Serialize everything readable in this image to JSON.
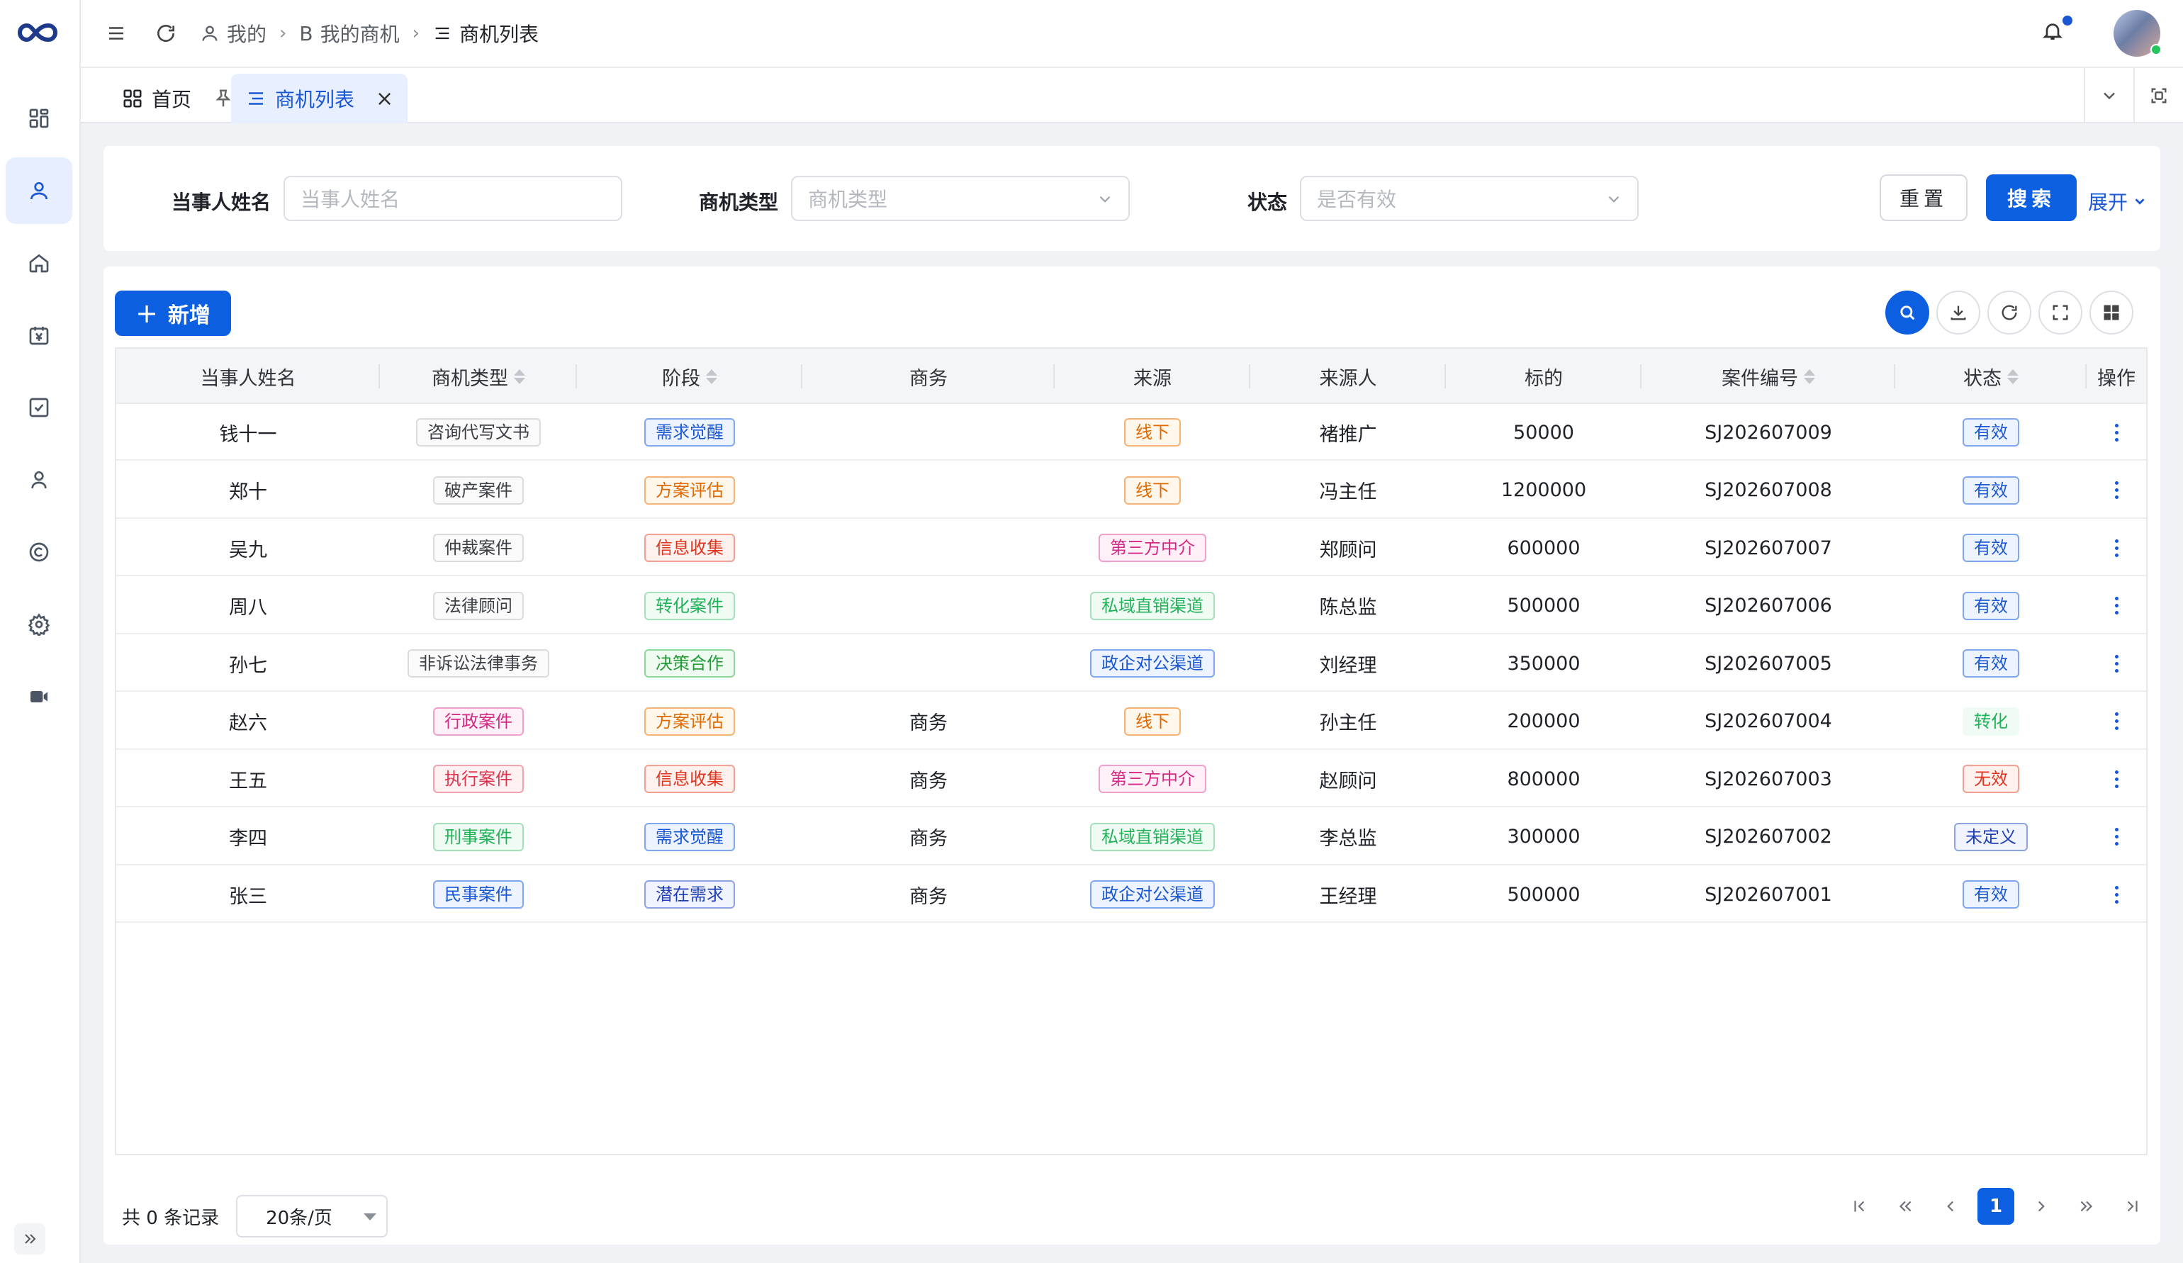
{
  "sidebar": {
    "items": [
      {
        "icon": "dashboard-icon",
        "active": false
      },
      {
        "icon": "user-icon",
        "active": true
      },
      {
        "icon": "home-icon",
        "active": false
      },
      {
        "icon": "yen-calendar-icon",
        "active": false
      },
      {
        "icon": "checkbox-icon",
        "active": false
      },
      {
        "icon": "person-icon",
        "active": false
      },
      {
        "icon": "copyright-icon",
        "active": false
      },
      {
        "icon": "settings-icon",
        "active": false
      },
      {
        "icon": "video-icon",
        "active": false
      }
    ]
  },
  "header": {
    "breadcrumbs": [
      {
        "label": "我的",
        "icon": "user-icon"
      },
      {
        "label": "我的商机",
        "icon": "b-letter-icon"
      },
      {
        "label": "商机列表",
        "icon": "list-icon"
      }
    ]
  },
  "tabs": [
    {
      "label": "首页",
      "icon": "dashboard-icon",
      "active": false
    },
    {
      "label": "商机列表",
      "icon": "list-icon",
      "active": true
    }
  ],
  "filters": {
    "party_name": {
      "label": "当事人姓名",
      "placeholder": "当事人姓名",
      "value": ""
    },
    "opportunity_type": {
      "label": "商机类型",
      "placeholder": "商机类型",
      "value": ""
    },
    "status": {
      "label": "状态",
      "placeholder": "是否有效",
      "value": ""
    },
    "reset_label": "重置",
    "search_label": "搜索",
    "expand_label": "展开"
  },
  "toolbar": {
    "add_label": "新增"
  },
  "table": {
    "columns": [
      "当事人姓名",
      "商机类型",
      "阶段",
      "商务",
      "来源",
      "来源人",
      "标的",
      "案件编号",
      "状态",
      "操作"
    ],
    "rows": [
      {
        "name": "钱十一",
        "type": "咨询代写文书",
        "type_color": "gray",
        "stage": "需求觉醒",
        "stage_color": "blue",
        "biz": "",
        "source": "线下",
        "source_color": "orange",
        "referrer": "褚推广",
        "amount": "50000",
        "case_no": "SJ202607009",
        "status": "有效",
        "status_color": "blue"
      },
      {
        "name": "郑十",
        "type": "破产案件",
        "type_color": "gray",
        "stage": "方案评估",
        "stage_color": "orange",
        "biz": "",
        "source": "线下",
        "source_color": "orange",
        "referrer": "冯主任",
        "amount": "1200000",
        "case_no": "SJ202607008",
        "status": "有效",
        "status_color": "blue"
      },
      {
        "name": "吴九",
        "type": "仲裁案件",
        "type_color": "gray",
        "stage": "信息收集",
        "stage_color": "red",
        "biz": "",
        "source": "第三方中介",
        "source_color": "magenta",
        "referrer": "郑顾问",
        "amount": "600000",
        "case_no": "SJ202607007",
        "status": "有效",
        "status_color": "blue"
      },
      {
        "name": "周八",
        "type": "法律顾问",
        "type_color": "gray",
        "stage": "转化案件",
        "stage_color": "green",
        "biz": "",
        "source": "私域直销渠道",
        "source_color": "green",
        "referrer": "陈总监",
        "amount": "500000",
        "case_no": "SJ202607006",
        "status": "有效",
        "status_color": "blue"
      },
      {
        "name": "孙七",
        "type": "非诉讼法律事务",
        "type_color": "gray",
        "stage": "决策合作",
        "stage_color": "darkgreen",
        "biz": "",
        "source": "政企对公渠道",
        "source_color": "blue",
        "referrer": "刘经理",
        "amount": "350000",
        "case_no": "SJ202607005",
        "status": "有效",
        "status_color": "blue"
      },
      {
        "name": "赵六",
        "type": "行政案件",
        "type_color": "magenta",
        "stage": "方案评估",
        "stage_color": "orange",
        "biz": "商务",
        "source": "线下",
        "source_color": "orange",
        "referrer": "孙主任",
        "amount": "200000",
        "case_no": "SJ202607004",
        "status": "转化",
        "status_color": "plain-green"
      },
      {
        "name": "王五",
        "type": "执行案件",
        "type_color": "rose",
        "stage": "信息收集",
        "stage_color": "red",
        "biz": "商务",
        "source": "第三方中介",
        "source_color": "magenta",
        "referrer": "赵顾问",
        "amount": "800000",
        "case_no": "SJ202607003",
        "status": "无效",
        "status_color": "red"
      },
      {
        "name": "李四",
        "type": "刑事案件",
        "type_color": "green",
        "stage": "需求觉醒",
        "stage_color": "blue",
        "biz": "商务",
        "source": "私域直销渠道",
        "source_color": "green",
        "referrer": "李总监",
        "amount": "300000",
        "case_no": "SJ202607002",
        "status": "未定义",
        "status_color": "navy"
      },
      {
        "name": "张三",
        "type": "民事案件",
        "type_color": "blue",
        "stage": "潜在需求",
        "stage_color": "navy",
        "biz": "商务",
        "source": "政企对公渠道",
        "source_color": "blue",
        "referrer": "王经理",
        "amount": "500000",
        "case_no": "SJ202607001",
        "status": "有效",
        "status_color": "blue"
      }
    ]
  },
  "pagination": {
    "total_text": "共 0 条记录",
    "page_size": "20条/页",
    "current_page": "1"
  },
  "colors": {
    "primary": "#0c5fe0",
    "active_bg": "#e6eeff"
  }
}
